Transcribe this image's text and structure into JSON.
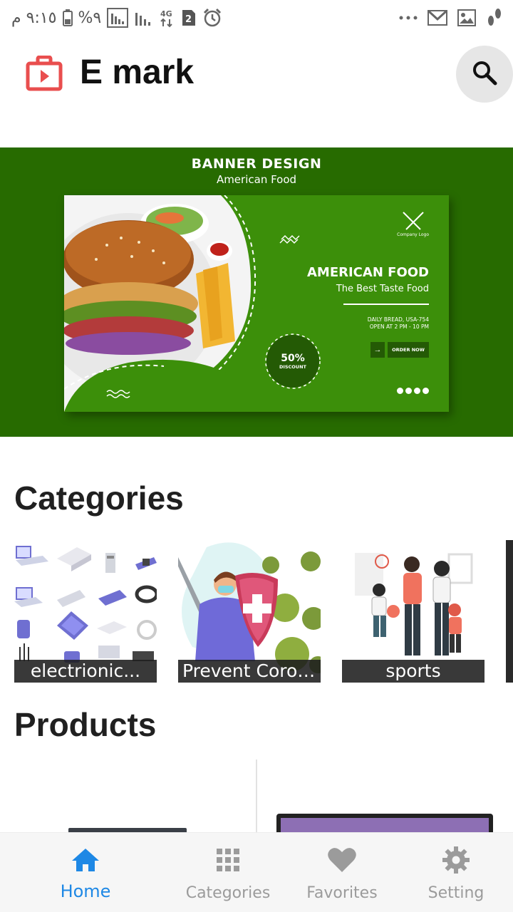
{
  "status_bar": {
    "time": "٩:١٥ م",
    "battery": "%٩",
    "network": "4G",
    "sim_badge": "2",
    "icons_left": [
      "battery-icon",
      "signal-icon",
      "signal-icon",
      "network-4g-icon",
      "sim-2-icon",
      "alarm-icon"
    ],
    "icons_right": [
      "more-icon",
      "gmail-icon",
      "gallery-icon",
      "footprint-icon"
    ]
  },
  "app_bar": {
    "title": "E mark",
    "logo_icon": "shopping-bag-play-icon",
    "search_icon": "search-icon",
    "logo_color": "#e94e4e"
  },
  "banner": {
    "title": "BANNER DESIGN",
    "subtitle": "American  Food",
    "ad": {
      "heading": "AMERICAN FOOD",
      "tagline": "The Best Taste Food",
      "info_line1": "DAILY BREAD, USA-754",
      "info_line2": "OPEN AT  2 PM - 10 PM",
      "order_label": "ORDER NOW",
      "discount_pct": "50%",
      "discount_label": "DISCOUNT",
      "logo_caption": "Company Logo"
    },
    "background": "#276b00"
  },
  "categories": {
    "title": "Categories",
    "items": [
      {
        "label": "electrionic...",
        "image": "electronics-illustration"
      },
      {
        "label": "Prevent Corona",
        "image": "prevent-corona-illustration"
      },
      {
        "label": "sports",
        "image": "sports-family-illustration"
      }
    ]
  },
  "products": {
    "title": "Products"
  },
  "bottom_nav": {
    "items": [
      {
        "label": "Home",
        "icon": "home-icon",
        "active": true
      },
      {
        "label": "Categories",
        "icon": "grid-icon",
        "active": false
      },
      {
        "label": "Favorites",
        "icon": "heart-icon",
        "active": false
      },
      {
        "label": "Setting",
        "icon": "gear-icon",
        "active": false
      }
    ],
    "active_color": "#1e88e5",
    "inactive_color": "#9b9b9b"
  }
}
